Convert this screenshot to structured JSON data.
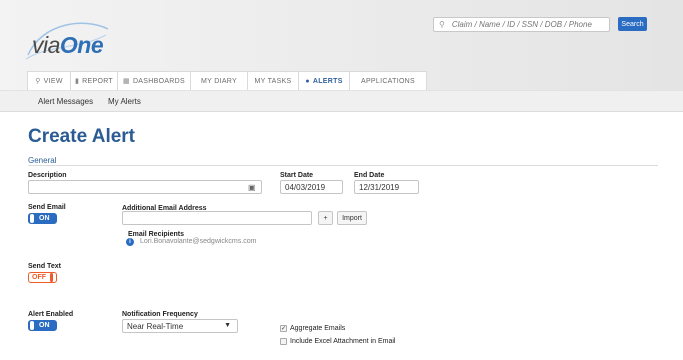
{
  "header": {
    "logo_prefix": "via",
    "logo_suffix": "One",
    "search_placeholder": "Claim / Name / ID / SSN / DOB / Phone",
    "search_button": "Search"
  },
  "tabs": [
    {
      "label": "VIEW",
      "icon": "search-icon"
    },
    {
      "label": "REPORT",
      "icon": "document-icon"
    },
    {
      "label": "DASHBOARDS",
      "icon": "grid-icon"
    },
    {
      "label": "MY DIARY"
    },
    {
      "label": "MY TASKS"
    },
    {
      "label": "ALERTS",
      "icon": "bell-icon",
      "active": true
    },
    {
      "label": "APPLICATIONS"
    }
  ],
  "subnav": {
    "alert_messages": "Alert Messages",
    "my_alerts": "My Alerts"
  },
  "page": {
    "title": "Create Alert",
    "section": "General"
  },
  "form": {
    "description_label": "Description",
    "description_value": "",
    "start_date_label": "Start Date",
    "start_date_value": "04/03/2019",
    "end_date_label": "End Date",
    "end_date_value": "12/31/2019",
    "send_email_label": "Send Email",
    "send_email_state": "ON",
    "additional_email_label": "Additional Email Address",
    "additional_email_value": "",
    "add_button": "+",
    "import_button": "Import",
    "email_recipients_label": "Email Recipients",
    "email_recipient": "Lori.Bonavolante@sedgwickcms.com",
    "send_text_label": "Send Text",
    "send_text_state": "OFF",
    "alert_enabled_label": "Alert Enabled",
    "alert_enabled_state": "ON",
    "notification_frequency_label": "Notification Frequency",
    "notification_frequency_value": "Near Real-Time",
    "aggregate_emails_label": "Aggregate Emails",
    "aggregate_emails_checked": true,
    "include_excel_label": "Include Excel Attachment in Email",
    "include_excel_checked": false
  },
  "colors": {
    "accent": "#2a6cc2",
    "title": "#2a5c93",
    "off": "#f05a28"
  }
}
